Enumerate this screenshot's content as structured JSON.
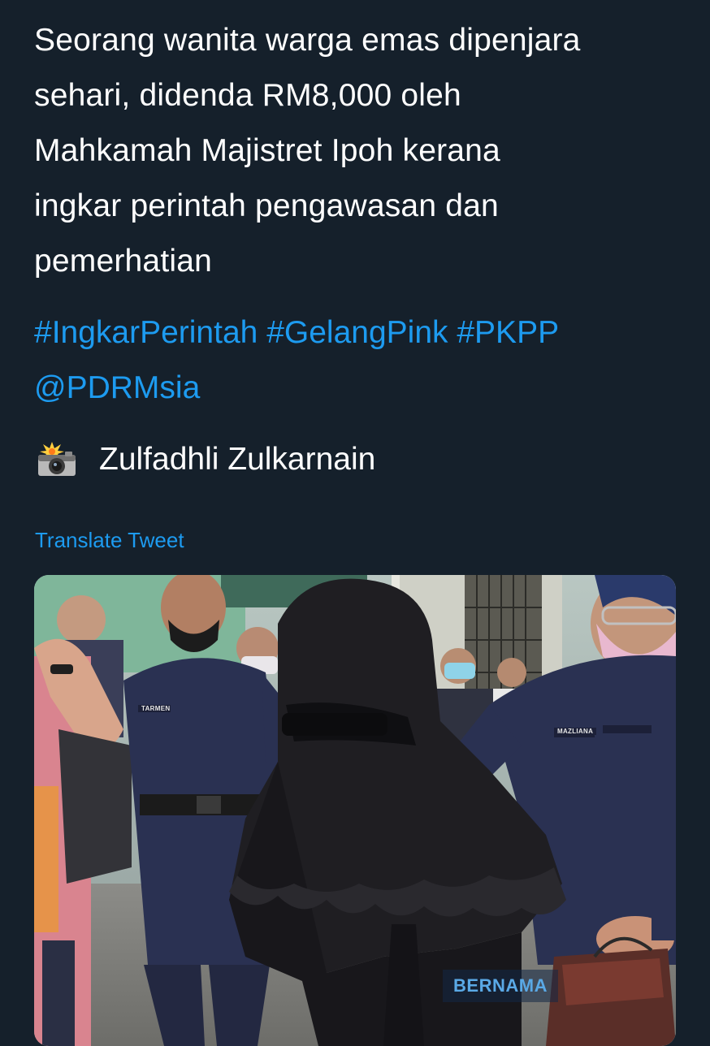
{
  "tweet": {
    "text_lines": [
      "Seorang wanita warga emas dipenjara",
      "sehari, didenda RM8,000 oleh",
      "Mahkamah Majistret Ipoh kerana",
      "ingkar perintah pengawasan dan",
      "pemerhatian"
    ],
    "hashtags": [
      "#IngkarPerintah",
      "#GelangPink",
      "#PKPP"
    ],
    "mention": "@PDRMsia",
    "credit_icon": "camera-with-flash-icon",
    "credit_name": "Zulfadhli Zulkarnain",
    "translate_label": "Translate Tweet"
  },
  "media": {
    "watermark": "BERNAMA",
    "name_tag_left": "TARMEN",
    "name_tag_right": "MAZLIANA",
    "description_hidden": false
  },
  "colors": {
    "background": "#15202b",
    "text": "#ffffff",
    "link": "#1d9bf0"
  }
}
